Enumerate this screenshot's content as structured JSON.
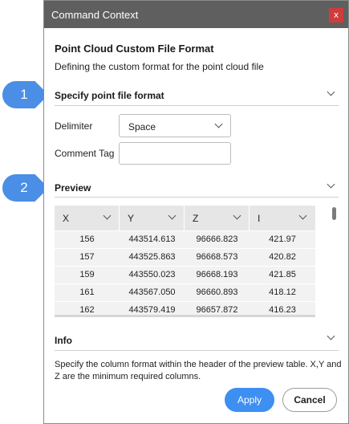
{
  "window": {
    "title": "Command Context",
    "close_glyph": "x"
  },
  "heading": "Point Cloud Custom File Format",
  "subheading": "Defining the custom format for the point cloud file",
  "callouts": [
    "1",
    "2"
  ],
  "sections": {
    "format": {
      "title": "Specify point file format"
    },
    "preview": {
      "title": "Preview"
    },
    "info": {
      "title": "Info"
    }
  },
  "fields": {
    "delimiter": {
      "label": "Delimiter",
      "value": "Space"
    },
    "comment_tag": {
      "label": "Comment Tag",
      "value": ""
    }
  },
  "table": {
    "columns": [
      "X",
      "Y",
      "Z",
      "I"
    ],
    "rows": [
      [
        "156",
        "443514.613",
        "96666.823",
        "421.97"
      ],
      [
        "157",
        "443525.863",
        "96668.573",
        "420.82"
      ],
      [
        "159",
        "443550.023",
        "96668.193",
        "421.85"
      ],
      [
        "161",
        "443567.050",
        "96660.893",
        "418.12"
      ],
      [
        "162",
        "443579.419",
        "96657.872",
        "416.23"
      ]
    ]
  },
  "info_text": "Specify the column format within the header of the preview table. X,Y and Z are the minimum required columns.",
  "buttons": {
    "apply": "Apply",
    "cancel": "Cancel"
  },
  "colors": {
    "accent": "#3d8ff2",
    "titlebar": "#5f5f5f",
    "close": "#d03b3b"
  }
}
